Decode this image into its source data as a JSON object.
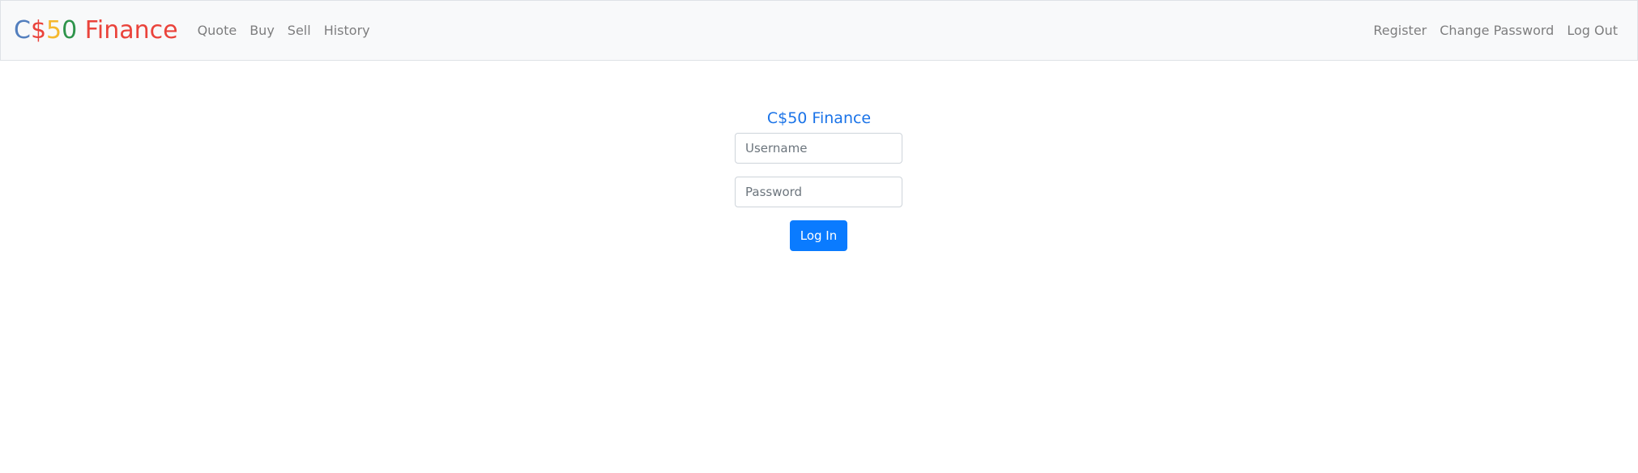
{
  "brand": {
    "part1": "C",
    "part2": "$",
    "part3": "5",
    "part4": "0",
    "part5": "Finance",
    "colors": {
      "blue": "#537fbe",
      "red": "#ea433b",
      "yellow": "#f5b82e",
      "green": "#2e944b"
    }
  },
  "nav": {
    "left": [
      "Quote",
      "Buy",
      "Sell",
      "History"
    ],
    "right": [
      "Register",
      "Change Password",
      "Log Out"
    ]
  },
  "login": {
    "title": "C$50 Finance",
    "username_placeholder": "Username",
    "username_value": "",
    "password_placeholder": "Password",
    "password_value": "",
    "submit_label": "Log In"
  },
  "colors": {
    "navbar_bg": "#f8f9fa",
    "primary": "#0a7bff",
    "title": "#1a73e8"
  }
}
